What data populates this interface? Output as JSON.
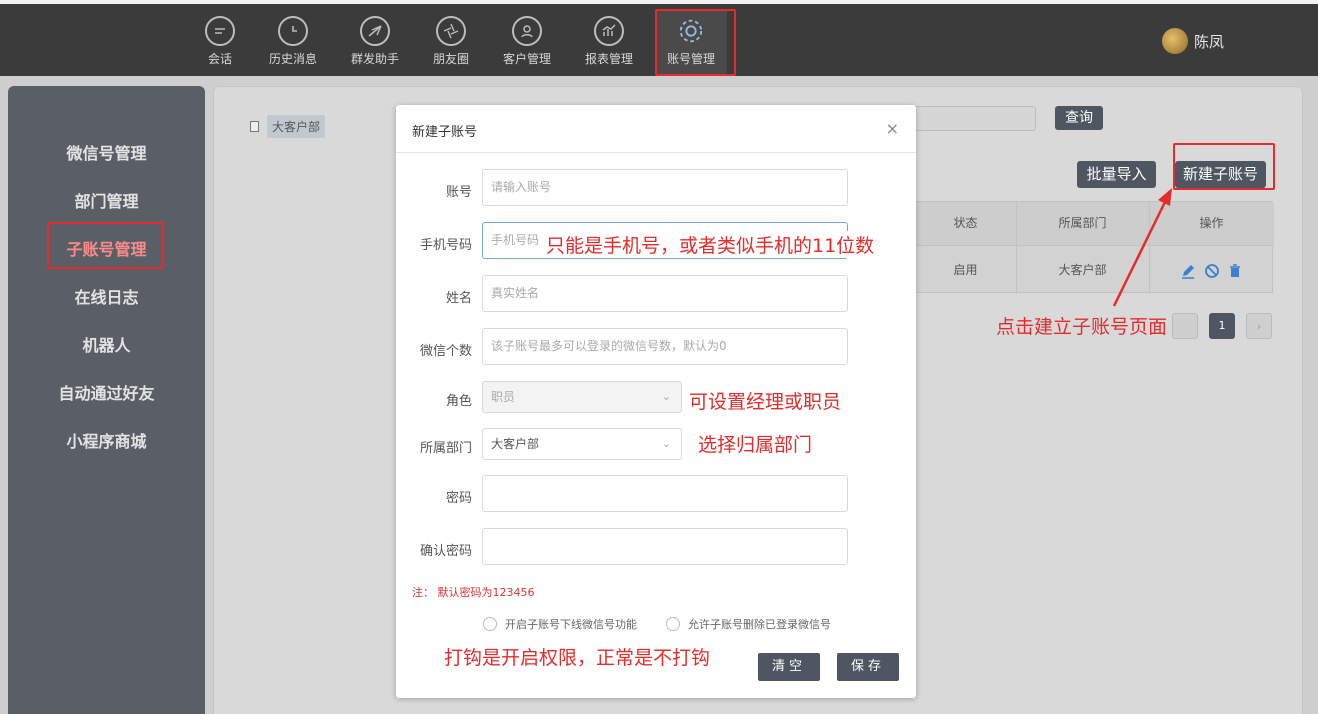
{
  "topnav": {
    "items": [
      {
        "label": "会话",
        "icon": "chat-icon"
      },
      {
        "label": "历史消息",
        "icon": "clock-icon"
      },
      {
        "label": "群发助手",
        "icon": "send-icon"
      },
      {
        "label": "朋友圈",
        "icon": "aperture-icon"
      },
      {
        "label": "客户管理",
        "icon": "user-icon"
      },
      {
        "label": "报表管理",
        "icon": "chart-icon"
      },
      {
        "label": "账号管理",
        "icon": "gear-icon"
      }
    ],
    "active": "账号管理",
    "user_name": "陈凤"
  },
  "sidebar": {
    "items": [
      {
        "label": "微信号管理"
      },
      {
        "label": "部门管理"
      },
      {
        "label": "子账号管理"
      },
      {
        "label": "在线日志"
      },
      {
        "label": "机器人"
      },
      {
        "label": "自动通过好友"
      },
      {
        "label": "小程序商城"
      }
    ],
    "active": "子账号管理"
  },
  "main": {
    "tree_item": "大客户部",
    "search_button": "查询",
    "import_button": "批量导入",
    "new_button": "新建子账号",
    "table": {
      "headers": [
        "状态",
        "所属部门",
        "操作"
      ],
      "rows": [
        {
          "status": "启用",
          "department": "大客户部"
        }
      ]
    },
    "current_page": "1"
  },
  "modal": {
    "title": "新建子账号",
    "close": "×",
    "fields": {
      "account": {
        "label": "账号",
        "placeholder": "请输入账号"
      },
      "phone": {
        "label": "手机号码",
        "placeholder": "手机号码（"
      },
      "name": {
        "label": "姓名",
        "placeholder": "真实姓名"
      },
      "wechat_count": {
        "label": "微信个数",
        "placeholder": "该子账号最多可以登录的微信号数，默认为0"
      },
      "role": {
        "label": "角色",
        "value": "职员"
      },
      "department": {
        "label": "所属部门",
        "value": "大客户部"
      },
      "password": {
        "label": "密码"
      },
      "confirm_password": {
        "label": "确认密码"
      }
    },
    "note": "注： 默认密码为123456",
    "checkboxes": [
      "开启子账号下线微信号功能",
      "允许子账号删除已登录微信号"
    ],
    "clear_button": "清空",
    "save_button": "保存"
  },
  "annotations": {
    "phone_hint": "只能是手机号，或者类似手机的11位数",
    "role_hint": "可设置经理或职员",
    "dept_hint": "选择归属部门",
    "checkbox_hint": "打钩是开启权限，正常是不打钩",
    "new_page_hint": "点击建立子账号页面"
  },
  "colors": {
    "annotation_red": "#e52b2b",
    "dark_button": "#4e5661",
    "topbar": "#3b3b3b",
    "sidebar": "#5a5e66"
  }
}
